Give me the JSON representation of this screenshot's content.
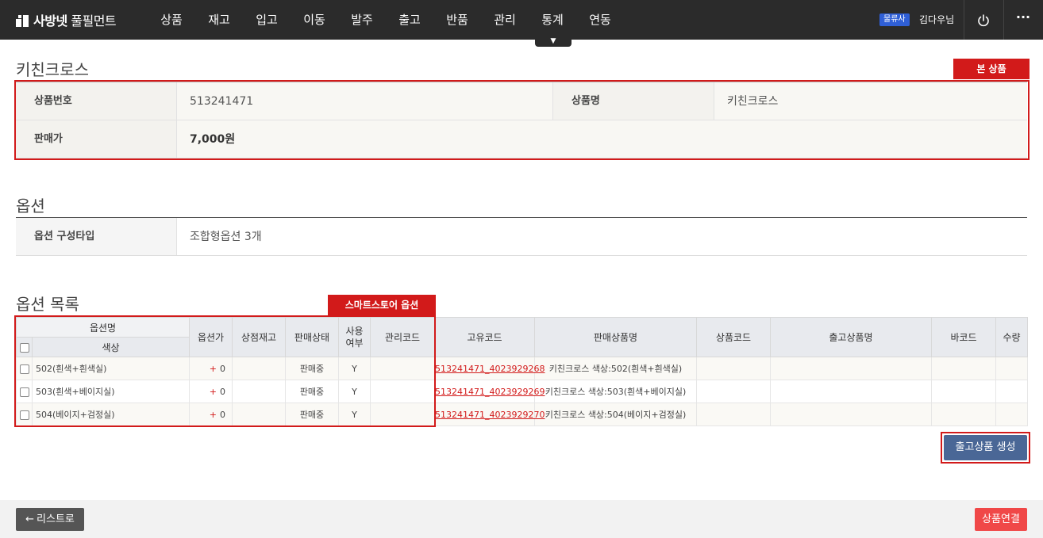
{
  "header": {
    "logo_bold": "사방넷",
    "logo_thin": " 풀필먼트",
    "menu": [
      "상품",
      "재고",
      "입고",
      "이동",
      "발주",
      "출고",
      "반품",
      "관리",
      "통계",
      "연동"
    ],
    "role_badge": "물류사",
    "user_name": "김다우님",
    "caret": "▼",
    "power_icon": "power-icon",
    "more_icon": "more-icon",
    "more_label": "···"
  },
  "product": {
    "title": "키친크로스",
    "tag": "본 상품",
    "fields": {
      "product_no_label": "상품번호",
      "product_no": "513241471",
      "product_name_label": "상품명",
      "product_name": "키친크로스",
      "price_label": "판매가",
      "price": "7,000원"
    }
  },
  "options": {
    "title": "옵션",
    "type_label": "옵션 구성타입",
    "type_value": "조합형옵션 3개"
  },
  "option_list": {
    "title": "옵션 목록",
    "tag": "스마트스토어 옵션",
    "headers": {
      "option_name": "옵션명",
      "color": "색상",
      "option_price": "옵션가",
      "store_stock": "상점재고",
      "sale_status": "판매상태",
      "use_yn_1": "사용",
      "use_yn_2": "여부",
      "manage_code": "관리코드",
      "unique_code": "고유코드",
      "sale_name": "판매상품명",
      "product_code": "상품코드",
      "ship_name": "출고상품명",
      "barcode": "바코드",
      "qty": "수량"
    },
    "rows": [
      {
        "color": "502(흰색+흰색실)",
        "plus": "+",
        "price": "0",
        "stock": "",
        "status": "판매중",
        "use": "Y",
        "manage": "",
        "unique": "513241471_4023929268",
        "sale_name": "키친크로스 색상:502(흰색+흰색실)",
        "product_code": "",
        "ship_name": "",
        "barcode": "",
        "qty": ""
      },
      {
        "color": "503(흰색+베이지실)",
        "plus": "+",
        "price": "0",
        "stock": "",
        "status": "판매중",
        "use": "Y",
        "manage": "",
        "unique": "513241471_4023929269",
        "sale_name": "키친크로스 색상:503(흰색+베이지실)",
        "product_code": "",
        "ship_name": "",
        "barcode": "",
        "qty": ""
      },
      {
        "color": "504(베이지+검정실)",
        "plus": "+",
        "price": "0",
        "stock": "",
        "status": "판매중",
        "use": "Y",
        "manage": "",
        "unique": "513241471_4023929270",
        "sale_name": "키친크로스 색상:504(베이지+검정실)",
        "product_code": "",
        "ship_name": "",
        "barcode": "",
        "qty": ""
      }
    ],
    "create_button": "출고상품 생성"
  },
  "footer": {
    "back_arrow": "←",
    "back_label": "리스트로",
    "link_label": "상품연결"
  },
  "colors": {
    "nav_bg": "#2b2b2b",
    "highlight_red": "#d21a1a",
    "primary_blue": "#4a6796",
    "link_red": "#f04848"
  }
}
